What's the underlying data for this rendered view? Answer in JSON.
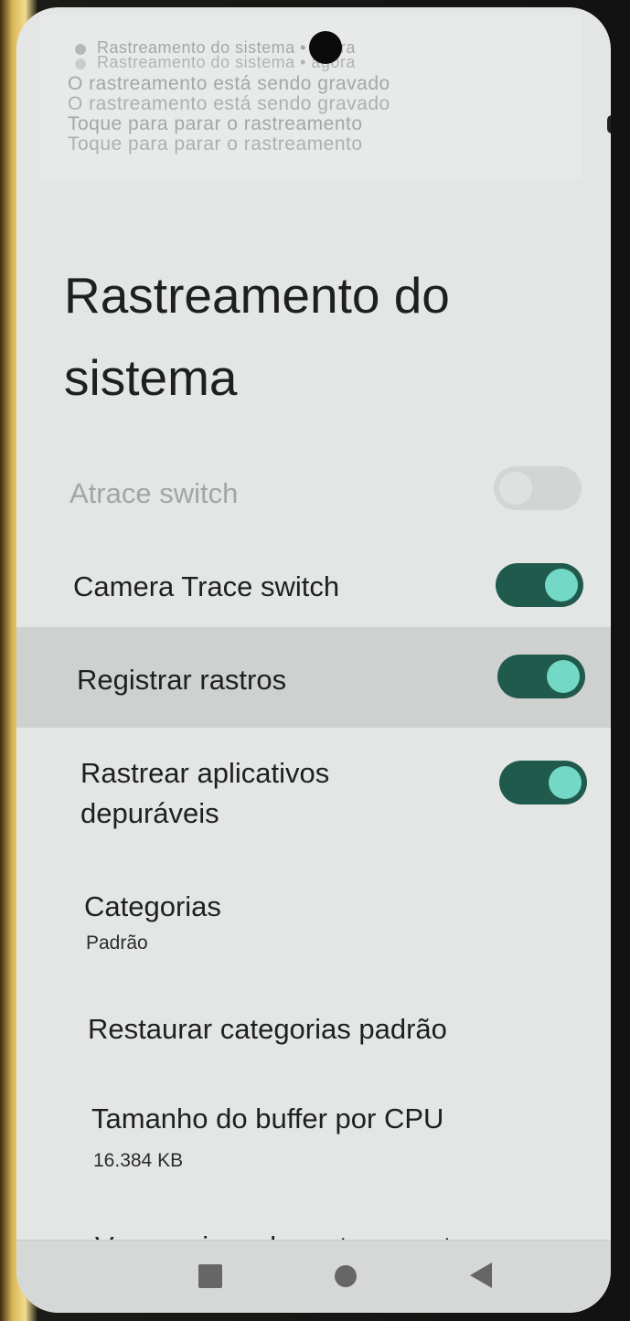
{
  "notification": {
    "line1": "Rastreamento do sistema • agora",
    "line2": "Rastreamento do sistema • agora",
    "line3": "O rastreamento está sendo gravado",
    "line4": "O rastreamento está sendo gravado",
    "line5": "Toque para parar o rastreamento",
    "line6": "Toque para parar o rastreamento"
  },
  "page": {
    "title": "Rastreamento do sistema"
  },
  "settings": {
    "atrace": {
      "label": "Atrace switch",
      "enabled": false,
      "on": false
    },
    "camera_trace": {
      "label": "Camera Trace switch",
      "on": true
    },
    "record_traces": {
      "label": "Registrar rastros",
      "on": true
    },
    "trace_debuggable_apps": {
      "label": "Rastrear aplicativos depuráveis",
      "on": true
    },
    "categories": {
      "label": "Categorias",
      "summary": "Padrão"
    },
    "restore_categories": {
      "label": "Restaurar categorias padrão"
    },
    "buffer_size": {
      "label": "Tamanho do buffer por CPU",
      "summary": "16.384 KB"
    },
    "view_files": {
      "label": "Ver arquivos de rastreamento"
    }
  },
  "navbar": {
    "recents": "square-icon",
    "home": "circle-icon",
    "back": "back-triangle-icon"
  },
  "colors": {
    "switch_track_on": "#1f5a4d",
    "switch_thumb_on": "#73d8c6",
    "highlight_row": "#cfd1d0"
  }
}
